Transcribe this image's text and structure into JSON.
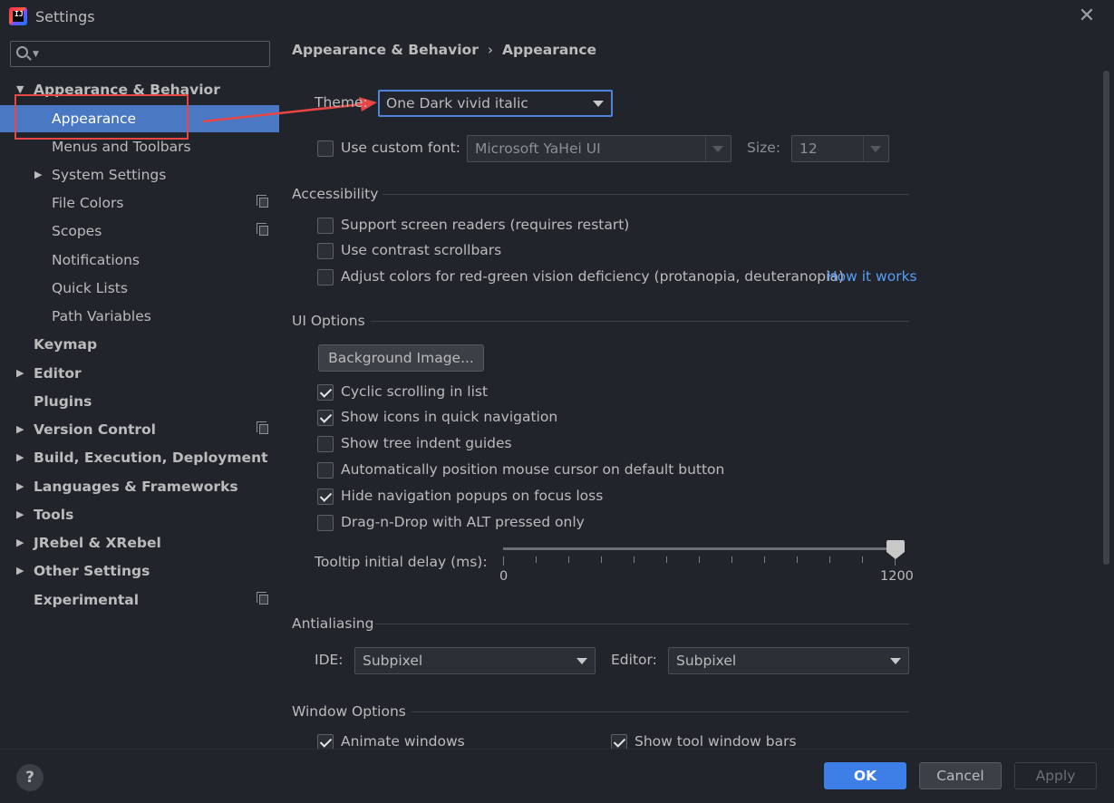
{
  "window": {
    "title": "Settings",
    "app_icon_text": "IJ"
  },
  "search": {
    "placeholder": ""
  },
  "sidebar": {
    "items": [
      {
        "label": "Appearance & Behavior",
        "arrow": "▼"
      },
      {
        "label": "Appearance"
      },
      {
        "label": "Menus and Toolbars"
      },
      {
        "label": "System Settings",
        "arrow": "▶"
      },
      {
        "label": "File Colors"
      },
      {
        "label": "Scopes"
      },
      {
        "label": "Notifications"
      },
      {
        "label": "Quick Lists"
      },
      {
        "label": "Path Variables"
      },
      {
        "label": "Keymap"
      },
      {
        "label": "Editor",
        "arrow": "▶"
      },
      {
        "label": "Plugins"
      },
      {
        "label": "Version Control",
        "arrow": "▶"
      },
      {
        "label": "Build, Execution, Deployment",
        "arrow": "▶"
      },
      {
        "label": "Languages & Frameworks",
        "arrow": "▶"
      },
      {
        "label": "Tools",
        "arrow": "▶"
      },
      {
        "label": "JRebel & XRebel",
        "arrow": "▶"
      },
      {
        "label": "Other Settings",
        "arrow": "▶"
      },
      {
        "label": "Experimental"
      }
    ]
  },
  "breadcrumb": {
    "parent": "Appearance & Behavior",
    "separator": "›",
    "current": "Appearance"
  },
  "theme": {
    "label": "Theme:",
    "value": "One Dark vivid italic"
  },
  "custom_font": {
    "label": "Use custom font:",
    "font": "Microsoft YaHei UI",
    "size_label": "Size:",
    "size": "12",
    "checked": false
  },
  "accessibility": {
    "title": "Accessibility",
    "options": [
      {
        "label": "Support screen readers (requires restart)",
        "checked": false
      },
      {
        "label": "Use contrast scrollbars",
        "checked": false
      },
      {
        "label": "Adjust colors for red-green vision deficiency (protanopia, deuteranopia)",
        "checked": false
      }
    ],
    "link": "How it works"
  },
  "ui_options": {
    "title": "UI Options",
    "background_button": "Background Image...",
    "options": [
      {
        "label": "Cyclic scrolling in list",
        "checked": true
      },
      {
        "label": "Show icons in quick navigation",
        "checked": true
      },
      {
        "label": "Show tree indent guides",
        "checked": false
      },
      {
        "label": "Automatically position mouse cursor on default button",
        "checked": false
      },
      {
        "label": "Hide navigation popups on focus loss",
        "checked": true
      },
      {
        "label": "Drag-n-Drop with ALT pressed only",
        "checked": false
      }
    ],
    "tooltip_label": "Tooltip initial delay (ms):",
    "slider_min": "0",
    "slider_max": "1200",
    "slider_value": 1200
  },
  "antialiasing": {
    "title": "Antialiasing",
    "ide_label": "IDE:",
    "ide_value": "Subpixel",
    "editor_label": "Editor:",
    "editor_value": "Subpixel"
  },
  "window_options": {
    "title": "Window Options",
    "options": [
      {
        "label": "Animate windows",
        "checked": true
      },
      {
        "label": "Show tool window bars",
        "checked": true
      }
    ]
  },
  "footer": {
    "help": "?",
    "ok": "OK",
    "cancel": "Cancel",
    "apply": "Apply"
  },
  "colors": {
    "selection": "#4a78c2",
    "accent": "#3d7fe6",
    "link": "#589df6",
    "annotation": "#e84545"
  }
}
